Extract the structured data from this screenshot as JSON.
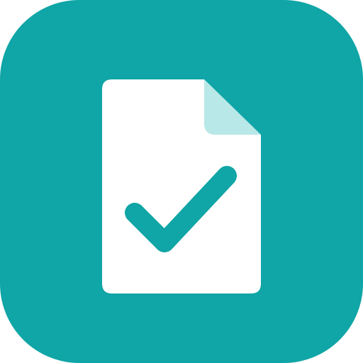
{
  "app_icon": {
    "icon_name": "document-check-icon",
    "colors": {
      "background": "#10A5A6",
      "page": "#FFFFFF",
      "page_fold": "#B8E8E8",
      "checkmark": "#10A5A6"
    }
  }
}
